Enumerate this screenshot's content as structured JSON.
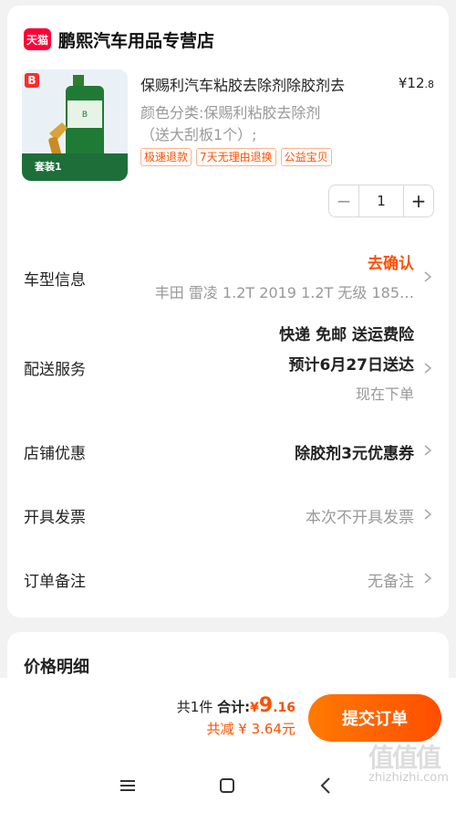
{
  "shop": {
    "badge": "天猫",
    "name": "鹏熙汽车用品专营店"
  },
  "product": {
    "title": "保赐利汽车粘胶去除剂除胶剂去",
    "price_symbol": "¥",
    "price_int": "12",
    "price_dec": ".8",
    "sku_line1": "颜色分类:保赐利粘胶去除剂",
    "sku_line2": "（送大刮板1个）;",
    "tags": [
      "极速退款",
      "7天无理由退换",
      "公益宝贝"
    ],
    "thumb_label": "套装1",
    "thumb_brand": "B"
  },
  "stepper": {
    "minus": "−",
    "qty": "1",
    "plus": "+"
  },
  "rows": {
    "car": {
      "label": "车型信息",
      "action": "去确认",
      "value": "丰田 雷凌 1.2T 2019 1.2T 无级 185…"
    },
    "delivery": {
      "label": "配送服务",
      "line1": "快递 免邮 送运费险",
      "line2": "预计6月27日送达",
      "line3": "现在下单"
    },
    "coupon": {
      "label": "店铺优惠",
      "value": "除胶剂3元优惠券"
    },
    "invoice": {
      "label": "开具发票",
      "value": "本次不开具发票"
    },
    "note": {
      "label": "订单备注",
      "value": "无备注"
    }
  },
  "price_section": {
    "title": "价格明细"
  },
  "bottom": {
    "count": "共1件",
    "total_label": "合计:",
    "currency": "¥",
    "total_int": "9",
    "total_dec": ".16",
    "discount": "共减 ¥ 3.64元",
    "submit": "提交订单"
  },
  "watermark": {
    "glyph": "值值值",
    "text": "zhizhizhi.com"
  },
  "colors": {
    "accent": "#ff5000",
    "tmall": "#ff0036",
    "button_start": "#ff7a00",
    "button_end": "#ff4e00"
  }
}
